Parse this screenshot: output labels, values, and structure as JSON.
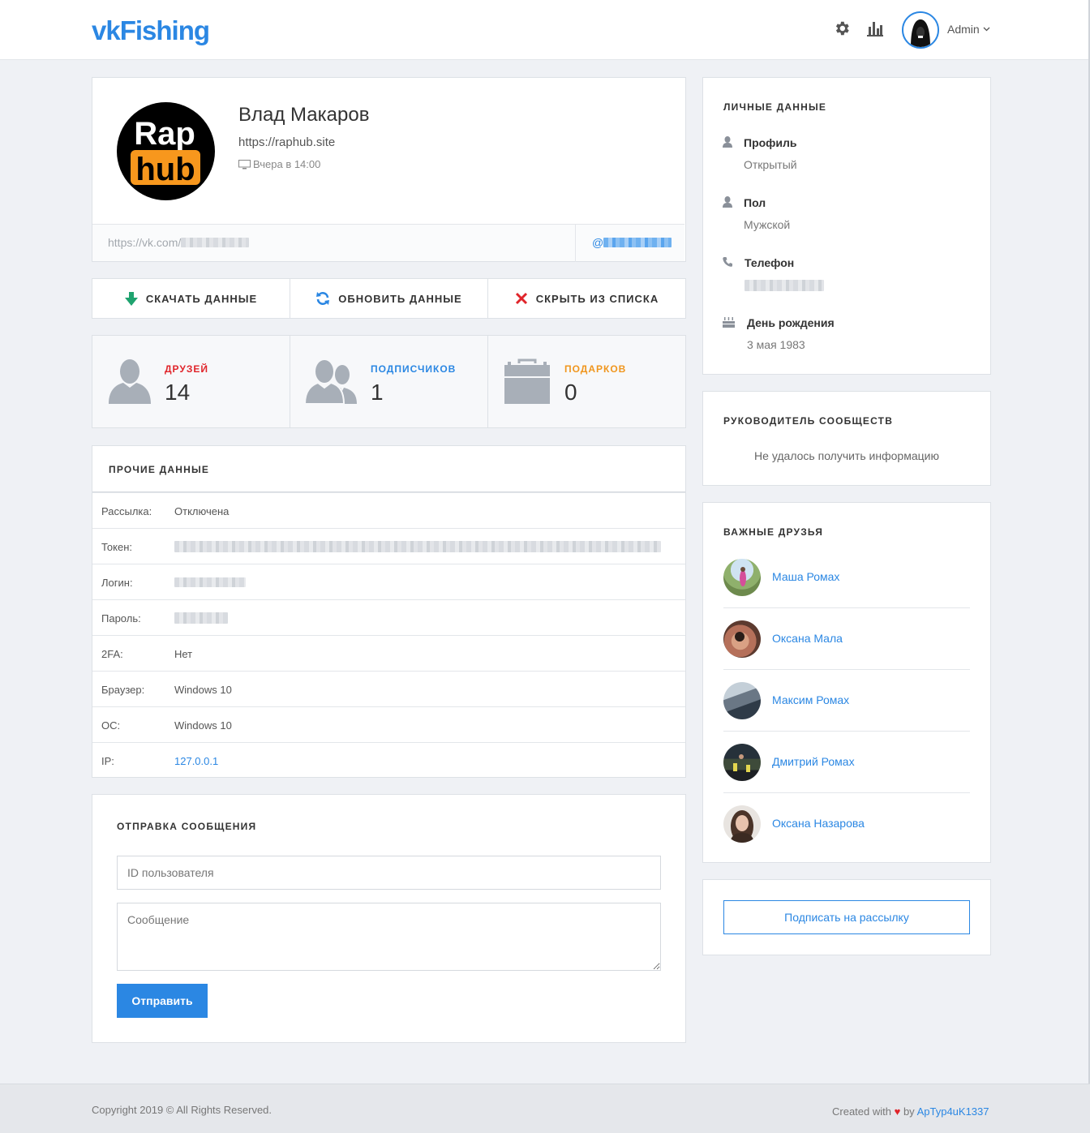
{
  "header": {
    "logo": "vkFishing",
    "user_name": "Admin",
    "icons": [
      "gear-icon",
      "bar-chart-icon",
      "chevron-down-icon"
    ]
  },
  "profile": {
    "avatar_text_top": "Rap",
    "avatar_text_bottom": "hub",
    "name": "Влад Макаров",
    "site": "https://raphub.site",
    "last_seen": "Вчера в 14:00",
    "vk_link_prefix": "https://vk.com/",
    "handle_prefix": "@"
  },
  "actions": {
    "download": "СКАЧАТЬ ДАННЫЕ",
    "refresh": "ОБНОВИТЬ ДАННЫЕ",
    "hide": "СКРЫТЬ ИЗ СПИСКА"
  },
  "stats": {
    "friends": {
      "label": "ДРУЗЕЙ",
      "value": "14",
      "color": "#e0242a"
    },
    "followers": {
      "label": "ПОДПИСЧИКОВ",
      "value": "1",
      "color": "#2b87e3"
    },
    "gifts": {
      "label": "ПОДАРКОВ",
      "value": "0",
      "color": "#f0961e"
    }
  },
  "other_data": {
    "title": "ПРОЧИЕ ДАННЫЕ",
    "rows": [
      {
        "key": "Рассылка:",
        "value": "Отключена"
      },
      {
        "key": "Токен:",
        "value": ""
      },
      {
        "key": "Логин:",
        "value": ""
      },
      {
        "key": "Пароль:",
        "value": ""
      },
      {
        "key": "2FA:",
        "value": "Нет"
      },
      {
        "key": "Браузер:",
        "value": "Windows 10"
      },
      {
        "key": "ОС:",
        "value": "Windows 10"
      },
      {
        "key": "IP:",
        "value": "127.0.0.1"
      }
    ]
  },
  "message": {
    "title": "ОТПРАВКА СООБЩЕНИЯ",
    "user_id_placeholder": "ID пользователя",
    "message_placeholder": "Сообщение",
    "send_label": "Отправить"
  },
  "personal": {
    "title": "ЛИЧНЫЕ ДАННЫЕ",
    "profile_label": "Профиль",
    "profile_value": "Открытый",
    "gender_label": "Пол",
    "gender_value": "Мужской",
    "phone_label": "Телефон",
    "birthday_label": "День рождения",
    "birthday_value": "3 мая 1983"
  },
  "communities": {
    "title": "РУКОВОДИТЕЛЬ СООБЩЕСТВ",
    "message": "Не удалось получить информацию"
  },
  "important_friends": {
    "title": "ВАЖНЫЕ ДРУЗЬЯ",
    "friends": [
      {
        "name": "Маша Ромах"
      },
      {
        "name": "Оксана Мала"
      },
      {
        "name": "Максим Ромах"
      },
      {
        "name": "Дмитрий Ромах"
      },
      {
        "name": "Оксана Назарова"
      }
    ]
  },
  "subscribe": {
    "label": "Подписать на рассылку"
  },
  "footer": {
    "copyright": "Copyright 2019 © All Rights Reserved.",
    "created_with": "Created with",
    "by": "by",
    "author": "ApTyp4uK1337",
    "heart_color": "#e0242a"
  }
}
